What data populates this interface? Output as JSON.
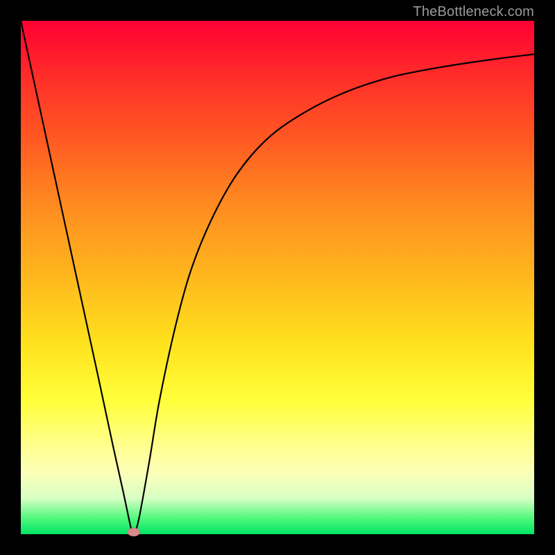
{
  "source_label": "TheBottleneck.com",
  "chart_data": {
    "type": "line",
    "title": "",
    "xlabel": "",
    "ylabel": "",
    "xlim": [
      0,
      100
    ],
    "ylim": [
      0,
      100
    ],
    "grid": false,
    "legend": false,
    "series": [
      {
        "name": "curve",
        "x": [
          0,
          5,
          10,
          15,
          18,
          20,
          21.5,
          22,
          23,
          25,
          27,
          30,
          33,
          37,
          42,
          48,
          55,
          63,
          72,
          82,
          92,
          100
        ],
        "values": [
          100,
          77,
          54,
          31,
          17,
          8,
          1,
          0,
          3,
          14,
          26,
          40,
          51,
          61,
          70,
          77,
          82,
          86,
          89,
          91,
          92.5,
          93.5
        ]
      }
    ],
    "marker": {
      "x": 22,
      "y": 0
    }
  },
  "colors": {
    "curve": "#000000",
    "gradient_top": "#ff0033",
    "gradient_mid": "#ffd21e",
    "gradient_bottom": "#00e565",
    "frame": "#000000",
    "marker": "#d98a8a"
  }
}
